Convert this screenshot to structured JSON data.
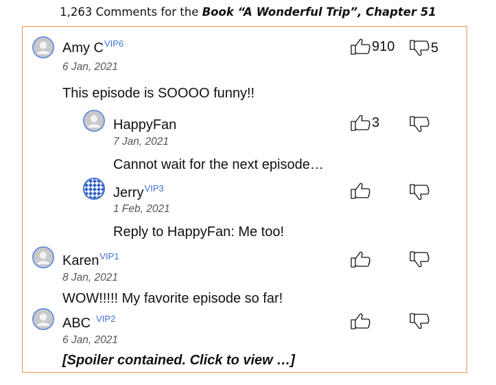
{
  "header": {
    "count_prefix": "1,263 Comments for the ",
    "book_ref": "Book “A Wonderful Trip”, Chapter 51"
  },
  "icons": {
    "thumb_up": "thumb-up-icon",
    "thumb_down": "thumb-down-icon",
    "avatar_default": "user-silhouette-icon",
    "avatar_pattern": "diamond-pattern-avatar"
  },
  "colors": {
    "panel_border": "#e8954a",
    "vip_badge": "#3d6fd1",
    "avatar_ring": "#6a8ed6"
  },
  "comments": [
    {
      "user": "Amy C",
      "vip": "VIP6",
      "date": "6 Jan, 2021",
      "text": "This episode is SOOOO funny!!",
      "likes": "910",
      "dislikes": "5",
      "replies": [
        {
          "user": "HappyFan",
          "vip": "",
          "date": "7 Jan, 2021",
          "text": "Cannot wait for the next episode…",
          "likes": "3",
          "dislikes": ""
        },
        {
          "user": "Jerry",
          "vip": "VIP3",
          "date": "1 Feb, 2021",
          "text": "Reply to HappyFan: Me too!",
          "likes": "",
          "dislikes": ""
        }
      ]
    },
    {
      "user": "Karen",
      "vip": "VIP1",
      "date": "8 Jan, 2021",
      "text": "WOW!!!!! My favorite episode so far!",
      "likes": "",
      "dislikes": ""
    },
    {
      "user": "ABC",
      "vip": "VIP2",
      "date": "6 Jan, 2021",
      "text": "[Spoiler contained. Click to view …]",
      "likes": "",
      "dislikes": ""
    }
  ]
}
